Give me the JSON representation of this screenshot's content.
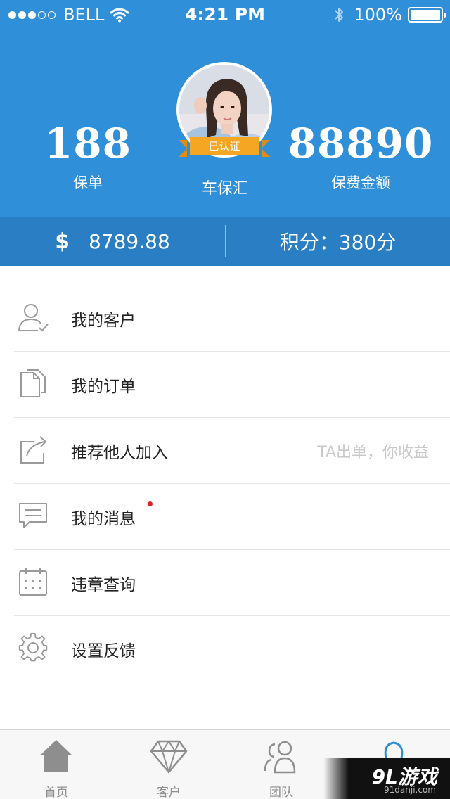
{
  "status_bar": {
    "signal_dots": [
      true,
      true,
      true,
      false,
      false
    ],
    "carrier": "BELL",
    "time": "4:21 PM",
    "battery_percent": "100%",
    "icons": [
      "wifi-icon",
      "bluetooth-icon",
      "battery-icon"
    ]
  },
  "profile": {
    "left_stat": {
      "value": "188",
      "label": "保单"
    },
    "right_stat": {
      "value": "88890",
      "label": "保费金额"
    },
    "badge": "已认证",
    "company": "车保汇"
  },
  "balance": {
    "currency_symbol": "$",
    "amount": "8789.88",
    "points": "积分：380分"
  },
  "menu": {
    "items": [
      {
        "label": "我的客户",
        "icon": "user-icon"
      },
      {
        "label": "我的订单",
        "icon": "documents-icon"
      },
      {
        "label": "推荐他人加入",
        "icon": "share-icon",
        "hint": "TA出单，你收益"
      },
      {
        "label": "我的消息",
        "icon": "message-icon",
        "unread": true
      },
      {
        "label": "违章查询",
        "icon": "calendar-icon"
      },
      {
        "label": "设置反馈",
        "icon": "gear-icon"
      }
    ]
  },
  "tabbar": {
    "tabs": [
      {
        "label": "首页",
        "icon": "home-icon"
      },
      {
        "label": "客户",
        "icon": "diamond-icon"
      },
      {
        "label": "团队",
        "icon": "team-icon"
      },
      {
        "label": "",
        "icon": "profile-icon",
        "active": true
      }
    ]
  },
  "watermark": {
    "main": "9L游戏",
    "sub": "91danji.com"
  },
  "colors": {
    "header_blue": "#2f8fd8",
    "balance_blue": "#2a7ec3",
    "badge_orange": "#f5a623",
    "unread_red": "#e02020"
  }
}
